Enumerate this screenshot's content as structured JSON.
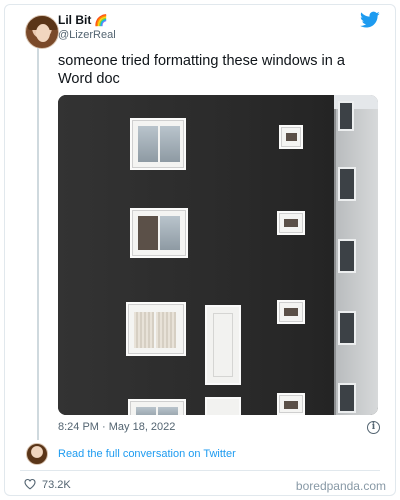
{
  "author": {
    "name": "Lil Bit",
    "emoji": "🌈",
    "handle": "@LizerReal"
  },
  "tweet": {
    "text": "someone tried formatting these windows in a Word doc",
    "timestamp": "8:24 PM · May 18, 2022",
    "read_more": "Read the full conversation on Twitter",
    "likes": "73.2K"
  },
  "icons": {
    "brand": "twitter-bird-icon",
    "info": "info-icon",
    "like": "heart-icon"
  },
  "colors": {
    "brand_blue": "#1d9bf0",
    "text": "#0f1419",
    "muted": "#536471"
  },
  "footer": {
    "watermark": "boredpanda.com"
  }
}
